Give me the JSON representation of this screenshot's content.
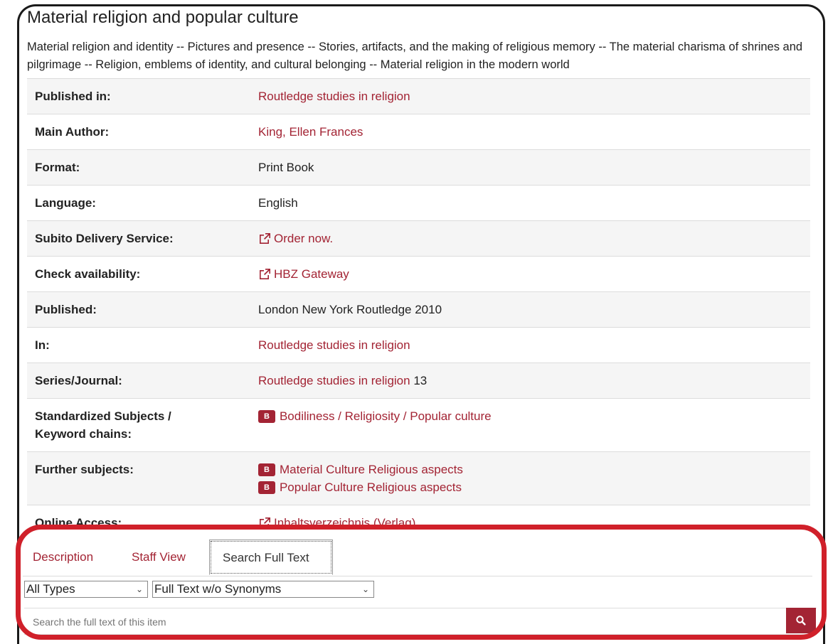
{
  "record": {
    "title": "Material religion and popular culture",
    "toc": "Material religion and identity -- Pictures and presence -- Stories, artifacts, and the making of religious memory -- The material charisma of shrines and pilgrimage -- Religion, emblems of identity, and cultural belonging -- Material religion in the modern world"
  },
  "details": {
    "published_in": {
      "label": "Published in:",
      "value": "Routledge studies in religion"
    },
    "main_author": {
      "label": "Main Author:",
      "value": "King, Ellen Frances"
    },
    "format": {
      "label": "Format:",
      "value": "Print Book"
    },
    "language": {
      "label": "Language:",
      "value": "English"
    },
    "subito": {
      "label": "Subito Delivery Service:",
      "value": "Order now."
    },
    "availability": {
      "label": "Check availability:",
      "value": "HBZ Gateway"
    },
    "published": {
      "label": "Published:",
      "value": "London New York Routledge 2010"
    },
    "in": {
      "label": "In:",
      "value": "Routledge studies in religion"
    },
    "series": {
      "label": "Series/Journal:",
      "value": "Routledge studies in religion",
      "number": "13"
    },
    "standardized": {
      "label_line1": "Standardized Subjects /",
      "label_line2": "Keyword chains:",
      "badge": "B",
      "value": "Bodiliness / Religiosity / Popular culture"
    },
    "further": {
      "label": "Further subjects:",
      "items": [
        {
          "badge": "B",
          "value": "Material Culture Religious aspects"
        },
        {
          "badge": "B",
          "value": "Popular Culture Religious aspects"
        }
      ]
    },
    "online": {
      "label": "Online Access:",
      "value": "Inhaltsverzeichnis (Verlag)"
    }
  },
  "tabs": {
    "description": "Description",
    "staff_view": "Staff View",
    "search_full_text": "Search Full Text"
  },
  "search": {
    "type_select": "All Types",
    "mode_select": "Full Text w/o Synonyms",
    "placeholder": "Search the full text of this item"
  },
  "colors": {
    "link": "#a32434",
    "highlight": "#d0202a"
  }
}
